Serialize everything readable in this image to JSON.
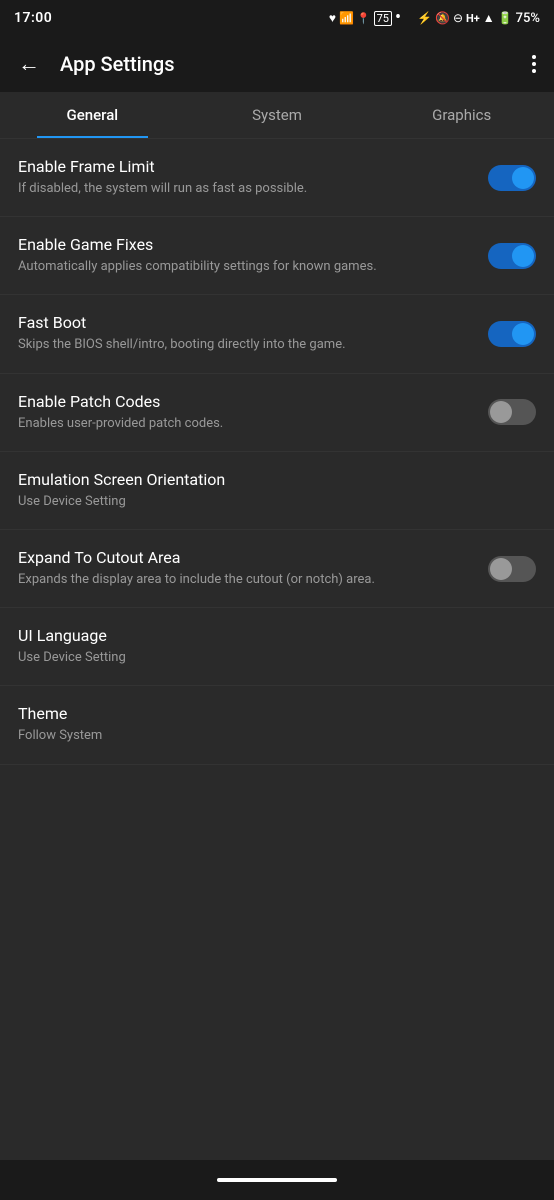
{
  "status_bar": {
    "time": "17:00",
    "battery": "75%",
    "icons": [
      "heart",
      "wifi-question",
      "location",
      "75-badge",
      "dot",
      "bluetooth",
      "bell-off",
      "minus-circle",
      "H+",
      "signal",
      "battery"
    ]
  },
  "header": {
    "title": "App Settings",
    "back_label": "←",
    "more_label": "⋮"
  },
  "tabs": [
    {
      "id": "general",
      "label": "General",
      "active": true
    },
    {
      "id": "system",
      "label": "System",
      "active": false
    },
    {
      "id": "graphics",
      "label": "Graphics",
      "active": false
    }
  ],
  "settings": [
    {
      "id": "frame-limit",
      "title": "Enable Frame Limit",
      "description": "If disabled, the system will run as fast as possible.",
      "type": "toggle",
      "enabled": true
    },
    {
      "id": "game-fixes",
      "title": "Enable Game Fixes",
      "description": "Automatically applies compatibility settings for known games.",
      "type": "toggle",
      "enabled": true
    },
    {
      "id": "fast-boot",
      "title": "Fast Boot",
      "description": "Skips the BIOS shell/intro, booting directly into the game.",
      "type": "toggle",
      "enabled": true
    },
    {
      "id": "patch-codes",
      "title": "Enable Patch Codes",
      "description": "Enables user-provided patch codes.",
      "type": "toggle",
      "enabled": false
    },
    {
      "id": "screen-orientation",
      "title": "Emulation Screen Orientation",
      "description": "Use Device Setting",
      "type": "select",
      "enabled": null
    },
    {
      "id": "cutout-area",
      "title": "Expand To Cutout Area",
      "description": "Expands the display area to include the cutout (or notch) area.",
      "type": "toggle",
      "enabled": false
    },
    {
      "id": "ui-language",
      "title": "UI Language",
      "description": "Use Device Setting",
      "type": "select",
      "enabled": null
    },
    {
      "id": "theme",
      "title": "Theme",
      "description": "Follow System",
      "type": "select",
      "enabled": null
    }
  ],
  "bottom_indicator": ""
}
